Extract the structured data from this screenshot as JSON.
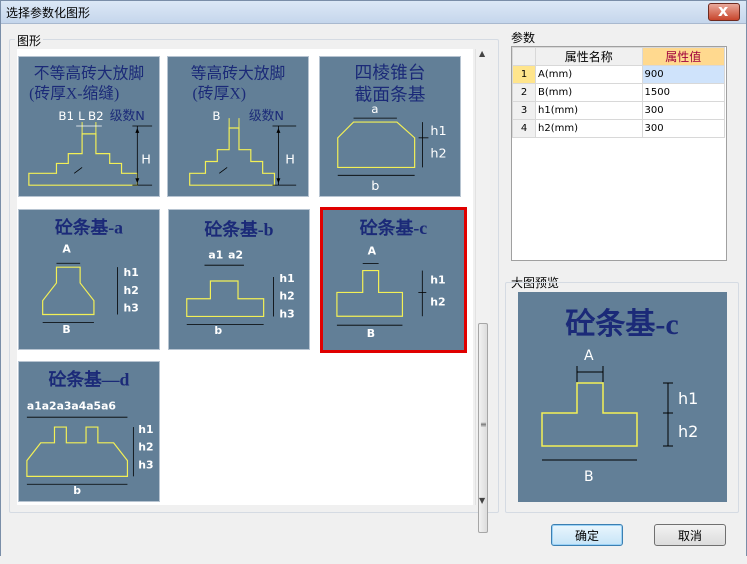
{
  "window": {
    "title": "选择参数化图形",
    "close_glyph": "x"
  },
  "gallery": {
    "label": "图形",
    "tiles": [
      {
        "title_line1": "不等高砖大放脚",
        "title_line2": "(砖厚X-缩缝)",
        "labels": [
          "B1",
          "L",
          "B2",
          "级数N",
          "H"
        ]
      },
      {
        "title_line1": "等高砖大放脚",
        "title_line2": "(砖厚X)",
        "labels": [
          "B",
          "级数N",
          "H"
        ]
      },
      {
        "title_line1": "四棱锥台",
        "title_line2": "截面条基",
        "labels": [
          "a",
          "h1",
          "h2",
          "b"
        ]
      },
      {
        "title": "砼条基-a",
        "labels": [
          "A",
          "h1",
          "h2",
          "h3",
          "B"
        ]
      },
      {
        "title": "砼条基-b",
        "labels": [
          "a1",
          "a2",
          "h1",
          "h2",
          "h3",
          "b"
        ]
      },
      {
        "title": "砼条基-c",
        "labels": [
          "A",
          "h1",
          "h2",
          "B"
        ]
      },
      {
        "title": "砼条基—d",
        "labels": [
          "a1a2a3a4a5a6",
          "h1",
          "h2",
          "h3",
          "b"
        ]
      }
    ],
    "selected_index": 5
  },
  "params": {
    "label": "参数",
    "col_name": "属性名称",
    "col_value": "属性值",
    "rows": [
      {
        "no": "1",
        "name": "A(mm)",
        "value": "900"
      },
      {
        "no": "2",
        "name": "B(mm)",
        "value": "1500"
      },
      {
        "no": "3",
        "name": "h1(mm)",
        "value": "300"
      },
      {
        "no": "4",
        "name": "h2(mm)",
        "value": "300"
      }
    ]
  },
  "preview": {
    "label": "大图预览",
    "title": "砼条基-c",
    "labels": [
      "A",
      "h1",
      "h2",
      "B"
    ]
  },
  "buttons": {
    "ok": "确定",
    "cancel": "取消"
  },
  "colors": {
    "tile_bg": "#627f97",
    "shape_yellow": "#f3f056",
    "title_navy": "#1b2a78",
    "selected_border": "#e00000"
  }
}
